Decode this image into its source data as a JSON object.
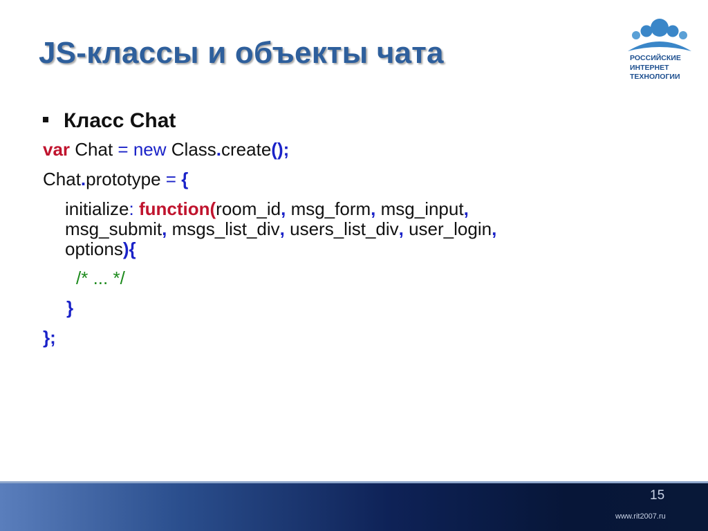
{
  "title": "JS-классы и объекты чата",
  "logo": {
    "icon": "people-group-icon",
    "lines": [
      "РОССИЙСКИЕ",
      "ИНТЕРНЕТ",
      "ТЕХНОЛОГИИ"
    ]
  },
  "bullet": "Класс Chat",
  "code": {
    "line1": {
      "kw": "var",
      "name": " Chat ",
      "eq": "=",
      "new_kw": " new ",
      "cls": "Class",
      "dot": ".",
      "method": "create",
      "paren": "();"
    },
    "line2": {
      "obj": "Chat",
      "dot": ".",
      "prop": "prototype ",
      "eq": "=",
      "brace": " {"
    },
    "line3": {
      "key": "initialize",
      "colon": ":",
      "func": " function",
      "open": "(",
      "a1": "room_id",
      "c1": ",",
      "a2": " msg_form",
      "c2": ",",
      "a3": " msg_input",
      "c3": ","
    },
    "line4": {
      "a4": "msg_submit",
      "c4": ",",
      "a5": " msgs_list_div",
      "c5": ",",
      "a6": " users_list_div",
      "c6": ",",
      "a7": " user_login",
      "c7": ","
    },
    "line5": {
      "a8": "options",
      "close": "){"
    },
    "line6": {
      "comment": "/* ... */"
    },
    "line7": {
      "brace": "}"
    },
    "line8": {
      "end": "};"
    }
  },
  "footer": {
    "slide_number": "15",
    "url": "www.rit2007.ru"
  },
  "colors": {
    "title": "#2e5f9c",
    "keyword": "#c0142e",
    "punctuation": "#1a22c8",
    "comment": "#1c8a1c"
  }
}
